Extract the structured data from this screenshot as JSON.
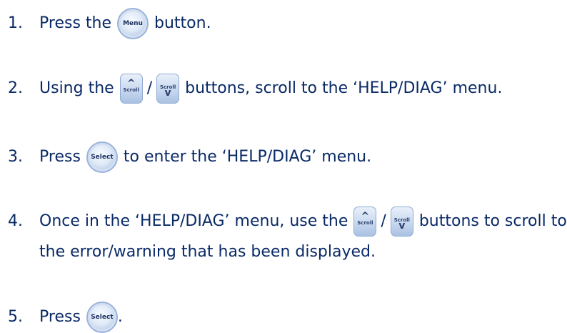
{
  "steps": [
    {
      "number": "1.",
      "parts": [
        "Press the",
        "button."
      ]
    },
    {
      "number": "2.",
      "parts": [
        "Using the",
        "/",
        "buttons, scroll to the ‘HELP/DIAG’ menu."
      ]
    },
    {
      "number": "3.",
      "parts": [
        "Press",
        "to enter the ‘HELP/DIAG’ menu."
      ]
    },
    {
      "number": "4.",
      "parts": [
        "Once in the ‘HELP/DIAG’ menu, use the",
        "/",
        "buttons to scroll to"
      ],
      "continuation": "the error/warning that has been displayed."
    },
    {
      "number": "5.",
      "parts": [
        "Press",
        "."
      ]
    }
  ],
  "buttons": {
    "menu": "Menu",
    "select": "Select",
    "scroll": "Scroll",
    "up_arrow": "^",
    "down_arrow": "v"
  },
  "colors": {
    "text": "#0a2a66",
    "button_fill": "#c5d6ee",
    "button_border": "#90aad3"
  }
}
